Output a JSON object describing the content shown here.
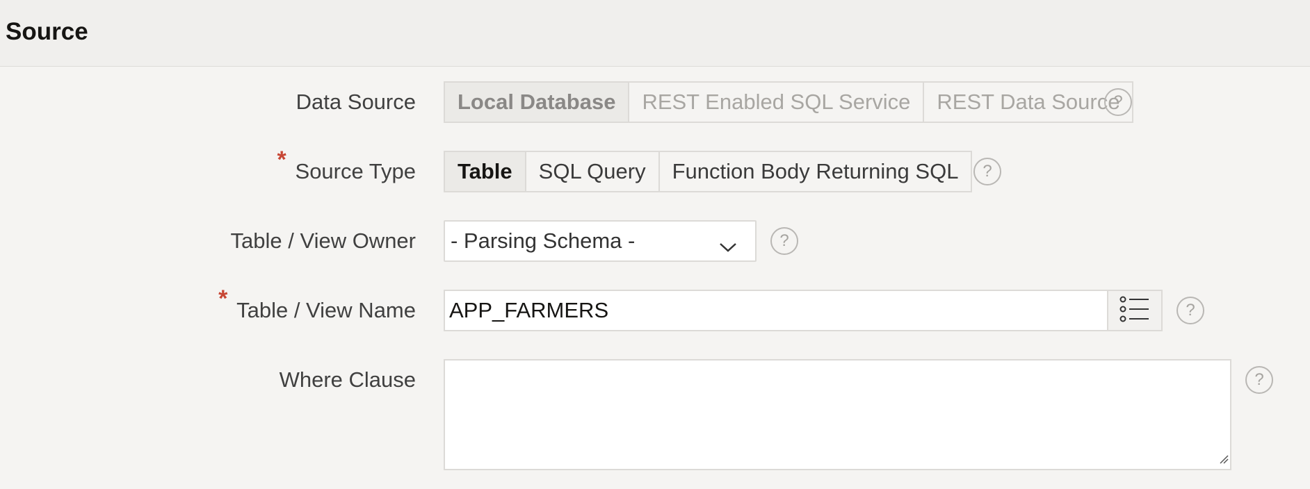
{
  "region": {
    "title": "Source"
  },
  "fields": {
    "data_source": {
      "label": "Data Source",
      "options": [
        "Local Database",
        "REST Enabled SQL Service",
        "REST Data Source"
      ],
      "selected": "Local Database",
      "disabled": true
    },
    "source_type": {
      "label": "Source Type",
      "required": true,
      "options": [
        "Table",
        "SQL Query",
        "Function Body Returning SQL"
      ],
      "selected": "Table"
    },
    "table_owner": {
      "label": "Table / View Owner",
      "value": "- Parsing Schema -"
    },
    "table_name": {
      "label": "Table / View Name",
      "required": true,
      "value": "APP_FARMERS"
    },
    "where_clause": {
      "label": "Where Clause",
      "value": ""
    }
  },
  "help_glyph": "?",
  "required_marker": "*",
  "icons": {
    "help": "help-icon",
    "chevron": "chevron-down-icon",
    "list": "list-icon",
    "resize": "resize-grip-icon"
  },
  "colors": {
    "background": "#f5f4f2",
    "header": "#f0efed",
    "required": "#c74634",
    "border": "#dcdad7"
  }
}
